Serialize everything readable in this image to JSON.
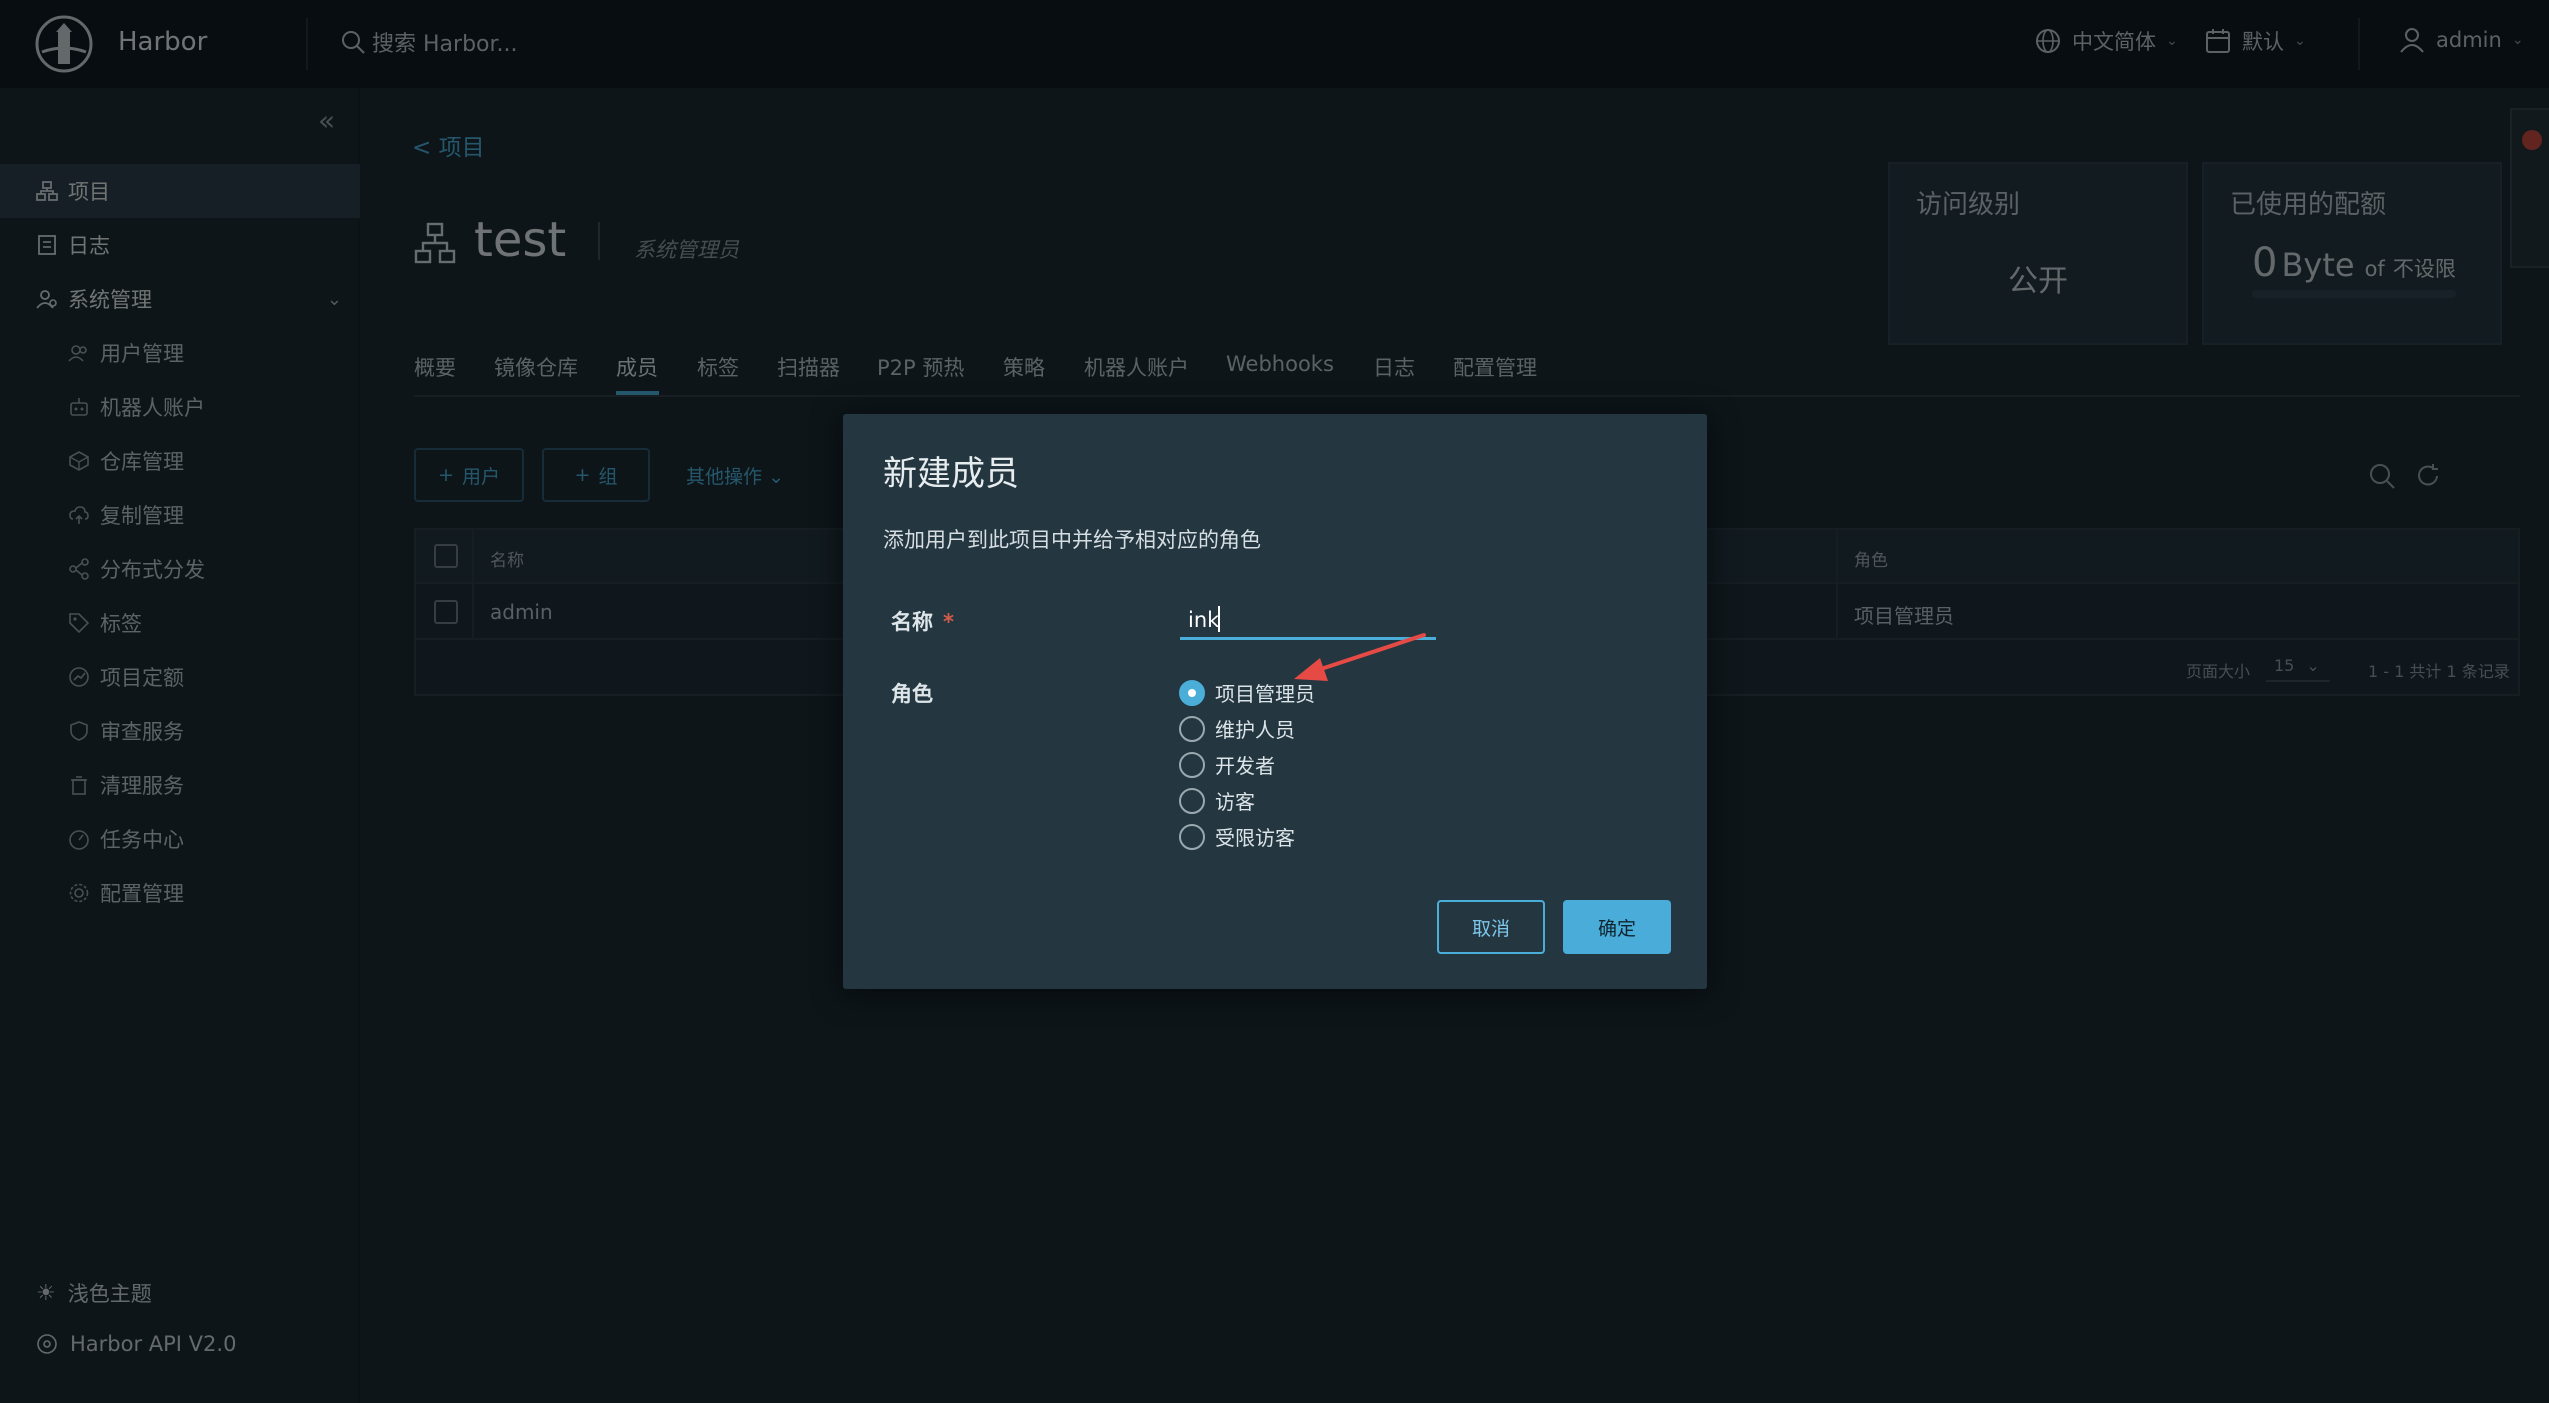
{
  "header": {
    "brand": "Harbor",
    "search_placeholder": "搜索 Harbor...",
    "language": "中文简体",
    "datetime_format": "默认",
    "user": "admin"
  },
  "sidebar": {
    "items": [
      {
        "label": "项目",
        "icon": "projects-icon",
        "active": true
      },
      {
        "label": "日志",
        "icon": "logs-icon"
      },
      {
        "label": "系统管理",
        "icon": "admin-icon",
        "expanded": true
      }
    ],
    "sub_items": [
      {
        "label": "用户管理",
        "icon": "users-icon"
      },
      {
        "label": "机器人账户",
        "icon": "robot-icon"
      },
      {
        "label": "仓库管理",
        "icon": "registry-icon"
      },
      {
        "label": "复制管理",
        "icon": "replication-icon"
      },
      {
        "label": "分布式分发",
        "icon": "distribution-icon"
      },
      {
        "label": "标签",
        "icon": "tag-icon"
      },
      {
        "label": "项目定额",
        "icon": "quota-icon"
      },
      {
        "label": "审查服务",
        "icon": "shield-icon"
      },
      {
        "label": "清理服务",
        "icon": "trash-icon"
      },
      {
        "label": "任务中心",
        "icon": "dashboard-icon"
      },
      {
        "label": "配置管理",
        "icon": "gear-icon"
      }
    ],
    "footer": {
      "theme": "浅色主题",
      "api": "Harbor API V2.0"
    }
  },
  "page": {
    "back_link": "< 项目",
    "project_name": "test",
    "role": "系统管理员",
    "access_card": {
      "label": "访问级别",
      "value": "公开"
    },
    "quota_card": {
      "label": "已使用的配额",
      "value_num": "0",
      "value_unit": "Byte",
      "value_of": "of",
      "value_limit": "不设限"
    },
    "tabs": [
      "概要",
      "镜像仓库",
      "成员",
      "标签",
      "扫描器",
      "P2P 预热",
      "策略",
      "机器人账户",
      "Webhooks",
      "日志",
      "配置管理"
    ],
    "active_tab": "成员",
    "toolbar": {
      "add_user": "用户",
      "add_group": "组",
      "more_ops": "其他操作"
    },
    "table": {
      "columns": [
        "名称",
        "角色"
      ],
      "rows": [
        {
          "name": "admin",
          "role": "项目管理员"
        }
      ],
      "page_size_label": "页面大小",
      "page_size": "15",
      "summary": "1 - 1 共计 1 条记录"
    }
  },
  "modal": {
    "title": "新建成员",
    "description": "添加用户到此项目中并给予相对应的角色",
    "name_label": "名称",
    "name_value": "ink",
    "role_label": "角色",
    "roles": [
      "项目管理员",
      "维护人员",
      "开发者",
      "访客",
      "受限访客"
    ],
    "selected_role": "项目管理员",
    "cancel_label": "取消",
    "ok_label": "确定"
  },
  "colors": {
    "accent": "#4aaed9",
    "header_bg": "#0f1b22",
    "page_bg": "#1b2a32",
    "modal_bg": "#243741",
    "arrow": "#e64a45"
  }
}
